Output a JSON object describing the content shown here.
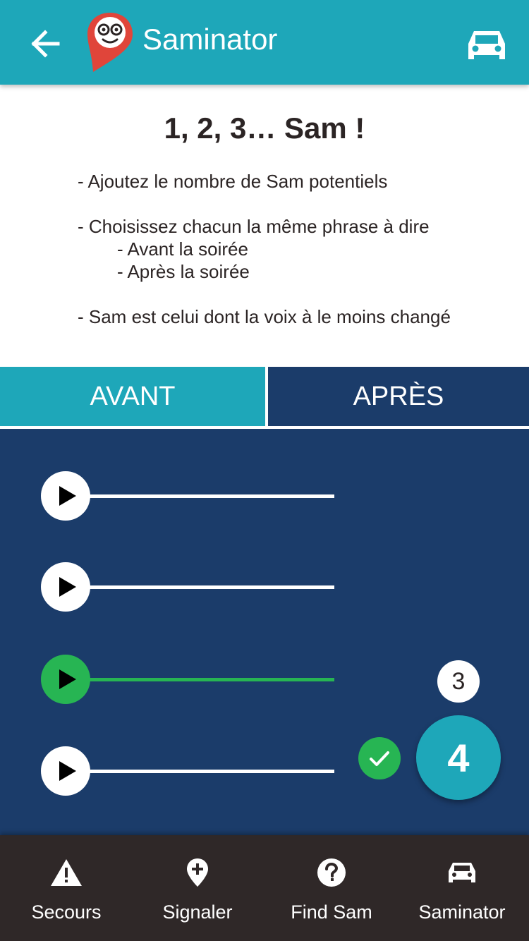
{
  "header": {
    "title": "Saminator",
    "back_icon": "arrow-left-icon",
    "logo_icon": "sam-logo-icon",
    "car_icon": "car-icon",
    "background": "#1ea7b9"
  },
  "instructions": {
    "title": "1, 2, 3… Sam !",
    "lines": [
      "- Ajoutez le nombre de Sam potentiels",
      "- Choisissez chacun la même phrase à dire",
      "- Avant la soirée",
      "- Après la soirée",
      "- Sam est celui dont la voix à le moins changé"
    ]
  },
  "tabs": [
    {
      "label": "AVANT",
      "selected": true
    },
    {
      "label": "APRÈS",
      "selected": false
    }
  ],
  "recordings": {
    "tracks": [
      {
        "active": false
      },
      {
        "active": false
      },
      {
        "active": true
      },
      {
        "active": false
      }
    ],
    "count_badge": "3",
    "fab_label": "4"
  },
  "bottom_nav": [
    {
      "label": "Secours",
      "icon": "warning-icon"
    },
    {
      "label": "Signaler",
      "icon": "map-pin-plus-icon"
    },
    {
      "label": "Find Sam",
      "icon": "help-circle-icon"
    },
    {
      "label": "Saminator",
      "icon": "car-icon"
    }
  ],
  "colors": {
    "primary": "#1ea7b9",
    "navy": "#1b3c6a",
    "green": "#27b553",
    "dark": "#2f2828",
    "logo_red": "#e0453a"
  }
}
